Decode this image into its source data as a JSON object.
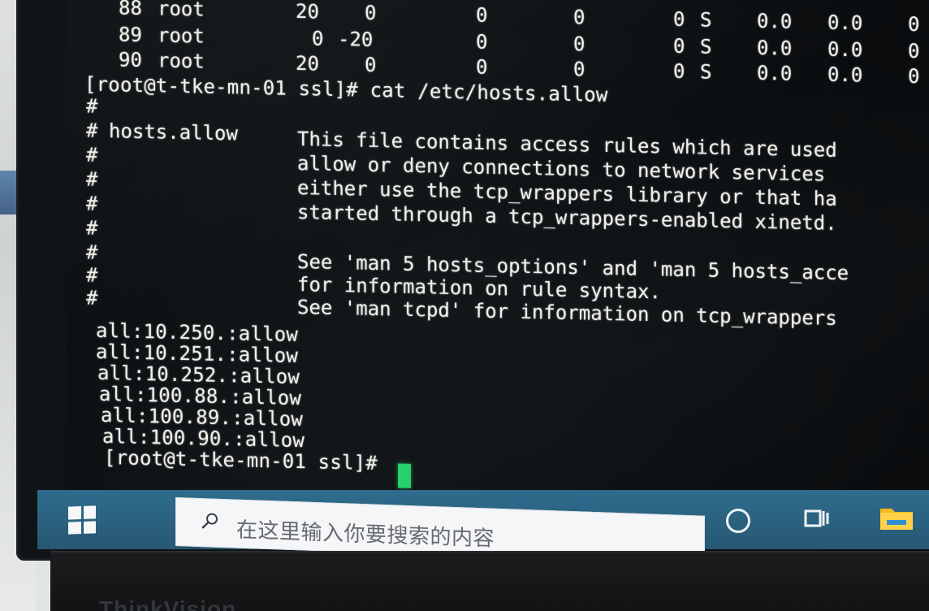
{
  "process_rows": [
    {
      "pid": "88",
      "user": "root",
      "pr": "20",
      "ni": "0",
      "virt": "0",
      "res": "0",
      "shr": "0",
      "s": "S",
      "cpu": "0.0",
      "mem": "0.0",
      "time": "0"
    },
    {
      "pid": "89",
      "user": "root",
      "pr": "0",
      "ni": "-20",
      "virt": "0",
      "res": "0",
      "shr": "0",
      "s": "S",
      "cpu": "0.0",
      "mem": "0.0",
      "time": "0"
    },
    {
      "pid": "90",
      "user": "root",
      "pr": "20",
      "ni": "0",
      "virt": "0",
      "res": "0",
      "shr": "0",
      "s": "S",
      "cpu": "0.0",
      "mem": "0.0",
      "time": "0"
    }
  ],
  "command_line": "[root@t-tke-mn-01 ssl]# cat /etc/hosts.allow",
  "comment_lines": [
    {
      "hash": "#",
      "label": "",
      "text": ""
    },
    {
      "hash": "#",
      "label": "hosts.allow",
      "text": "This file contains access rules which are used"
    },
    {
      "hash": "#",
      "label": "",
      "text": "allow or deny connections to network services"
    },
    {
      "hash": "#",
      "label": "",
      "text": "either use the tcp_wrappers library or that ha"
    },
    {
      "hash": "#",
      "label": "",
      "text": "started through a tcp_wrappers-enabled xinetd."
    },
    {
      "hash": "#",
      "label": "",
      "text": ""
    },
    {
      "hash": "#",
      "label": "",
      "text": "See 'man 5 hosts_options' and 'man 5 hosts_acce"
    },
    {
      "hash": "#",
      "label": "",
      "text": "for information on rule syntax."
    },
    {
      "hash": "#",
      "label": "",
      "text": "See 'man tcpd' for information on tcp_wrappers"
    }
  ],
  "rules": [
    "all:10.250.:allow",
    "all:10.251.:allow",
    "all:10.252.:allow",
    "all:100.88.:allow",
    "all:100.89.:allow",
    "all:100.90.:allow"
  ],
  "prompt": "[root@t-tke-mn-01 ssl]#",
  "taskbar": {
    "search_placeholder": "在这里输入你要搜索的内容"
  },
  "brand": "ThinkVision",
  "colors": {
    "terminal_text": "#f1f1ea",
    "cursor": "#22d06a",
    "taskbar": "#2f6c8e"
  }
}
